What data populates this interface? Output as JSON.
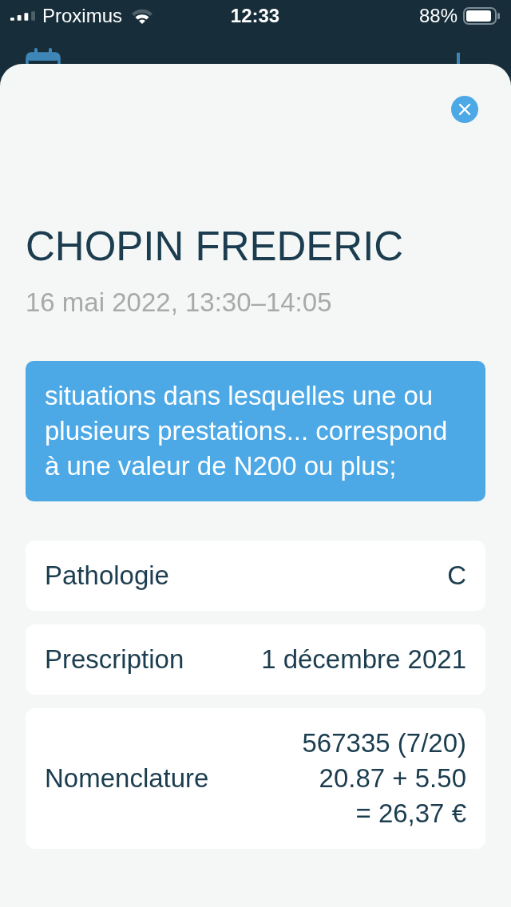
{
  "status_bar": {
    "carrier": "Proximus",
    "time": "12:33",
    "battery": "88%"
  },
  "sheet": {
    "title": "CHOPIN FREDERIC",
    "datetime": "16 mai 2022, 13:30–14:05",
    "note": "situations dans lesquelles une ou plusieurs prestations... correspond à une valeur de N200 ou plus;",
    "details": [
      {
        "label": "Pathologie",
        "value_lines": [
          "C"
        ]
      },
      {
        "label": "Prescription",
        "value_lines": [
          "1 décembre 2021"
        ]
      },
      {
        "label": "Nomenclature",
        "value_lines": [
          "567335 (7/20)",
          "20.87 + 5.50",
          "= 26,37 €"
        ]
      }
    ]
  }
}
